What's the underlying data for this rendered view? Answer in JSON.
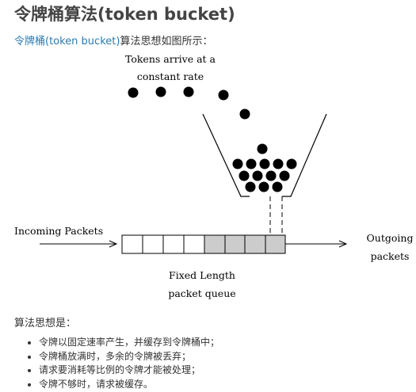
{
  "title": "令牌桶算法(token bucket)",
  "intro": {
    "link_text": "令牌桶(token bucket)",
    "rest_text": "算法思想如图所示："
  },
  "diagram": {
    "tokens_label_line1": "Tokens arrive at a",
    "tokens_label_line2": "constant rate",
    "incoming_label": "Incoming Packets",
    "outgoing_label_line1": "Outgoing",
    "outgoing_label_line2": "packets",
    "queue_label_line1": "Fixed Length",
    "queue_label_line2": "packet queue"
  },
  "subhead": "算法思想是：",
  "points": [
    "令牌以固定速率产生，并缓存到令牌桶中；",
    "令牌桶放满时，多余的令牌被丢弃；",
    "请求要消耗等比例的令牌才能被处理；",
    "令牌不够时，请求被缓存。"
  ]
}
